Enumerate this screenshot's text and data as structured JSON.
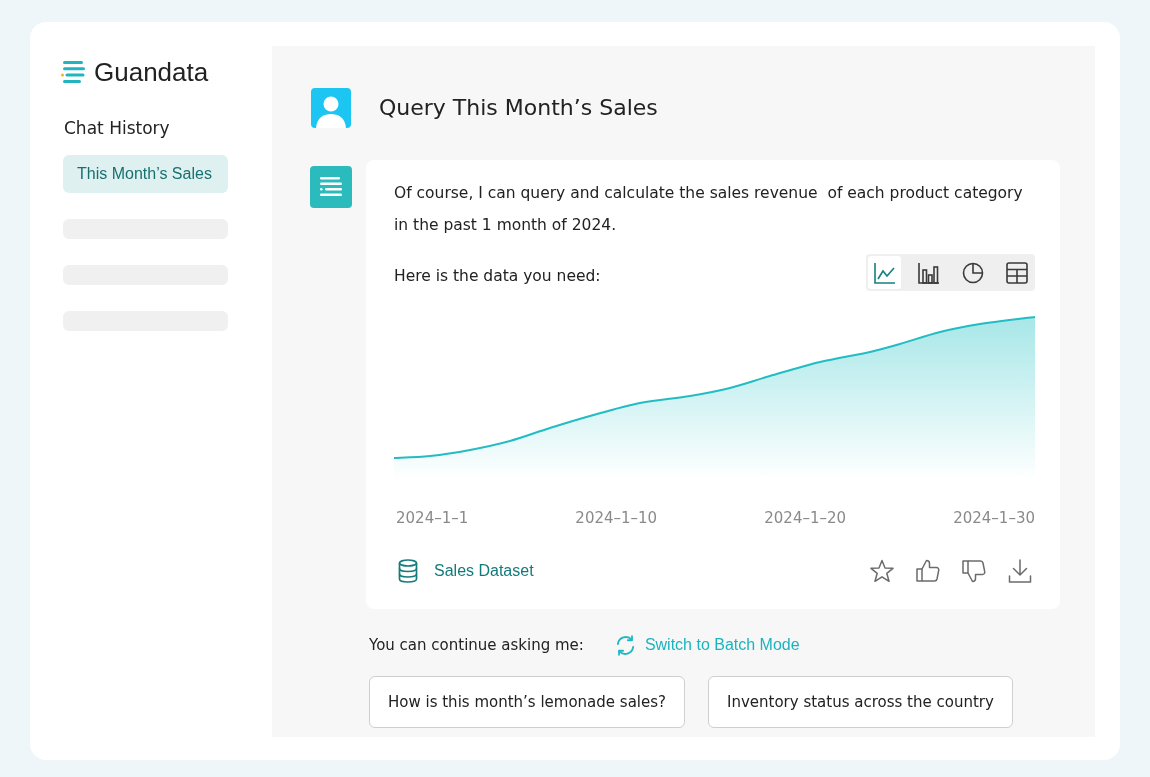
{
  "sidebar": {
    "logo": "Guandata",
    "heading": "Chat History",
    "history": [
      {
        "kind": "chat",
        "label": "This Month’s Sales",
        "selected": true
      },
      {
        "kind": "placeholder",
        "selected": false
      },
      {
        "kind": "placeholder",
        "selected": false
      },
      {
        "kind": "placeholder",
        "selected": false
      }
    ]
  },
  "conversation": {
    "question": "Query This Month’s Sales",
    "answer": {
      "text": "Of course, I can query and calculate the sales revenue  of each product category in the past 1 month of 2024.",
      "data_intro": "Here is the data you need:",
      "chart_types": [
        {
          "kind": "line",
          "selected": true
        },
        {
          "kind": "bar",
          "selected": false
        },
        {
          "kind": "pie",
          "selected": false
        },
        {
          "kind": "table",
          "selected": false
        }
      ],
      "axis_labels": [
        "2024–1–1",
        "2024–1–10",
        "2024–1–20",
        "2024–1–30"
      ],
      "dataset": "Sales Dataset"
    }
  },
  "follow_up": {
    "prompt": "You can continue asking me:",
    "switch_link": "Switch to Batch Mode",
    "suggestions": [
      "How is this month’s lemonade sales?",
      "Inventory status across the country"
    ]
  }
}
